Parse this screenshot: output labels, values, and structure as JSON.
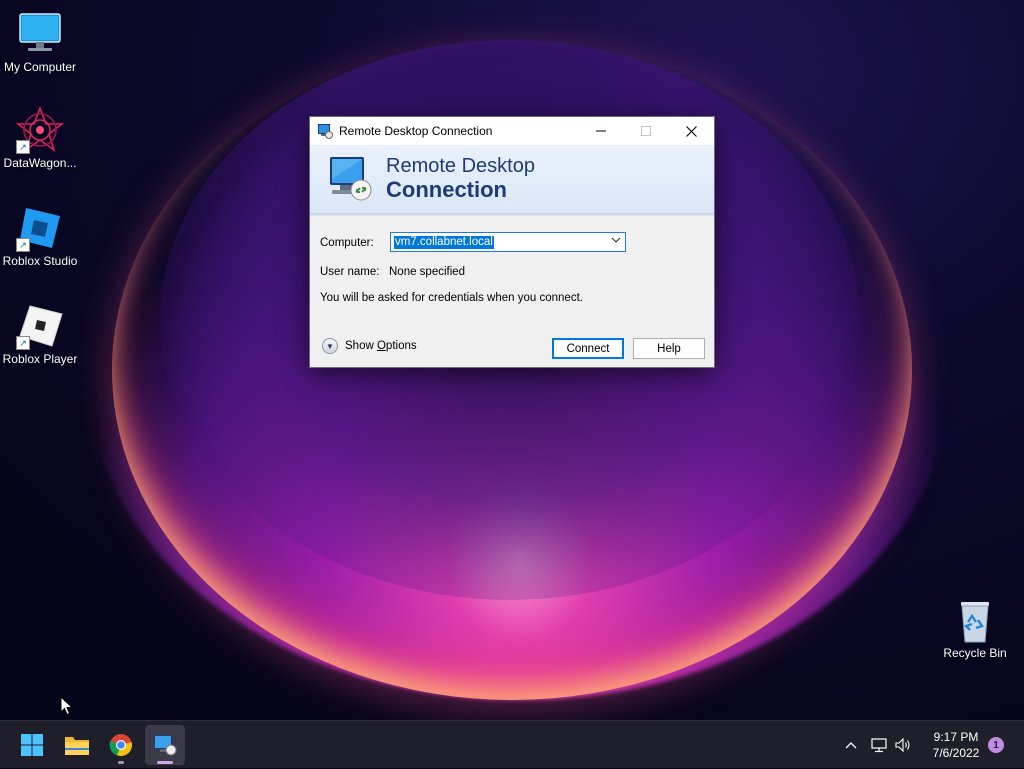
{
  "desktop": {
    "icons": [
      {
        "label": "My Computer",
        "icon": "monitor-icon"
      },
      {
        "label": "DataWagon...",
        "icon": "datawagon-icon"
      },
      {
        "label": "Roblox Studio",
        "icon": "roblox-studio-icon"
      },
      {
        "label": "Roblox Player",
        "icon": "roblox-player-icon"
      }
    ],
    "recycle_bin": {
      "label": "Recycle Bin",
      "icon": "recycle-bin-icon"
    }
  },
  "window": {
    "title": "Remote Desktop Connection",
    "banner": {
      "line1": "Remote Desktop",
      "line2": "Connection"
    },
    "computer_label": "Computer:",
    "computer_value": "vm7.collabnet.local",
    "username_label": "User name:",
    "username_value": "None specified",
    "info_text": "You will be asked for credentials when you connect.",
    "show_options_pre": "Show ",
    "show_options_underlined": "O",
    "show_options_post": "ptions",
    "connect_label": "Connect",
    "help_label": "Help"
  },
  "taskbar": {
    "apps": [
      "start-button",
      "file-explorer",
      "chrome",
      "remote-desktop-connection"
    ],
    "tray": {
      "time": "9:17 PM",
      "date": "7/6/2022",
      "notification_count": "1"
    }
  },
  "colors": {
    "accent": "#0078d7",
    "banner_text": "#1c3b77",
    "taskbar": "#1f1f2a",
    "notification_badge": "#c08be0"
  }
}
